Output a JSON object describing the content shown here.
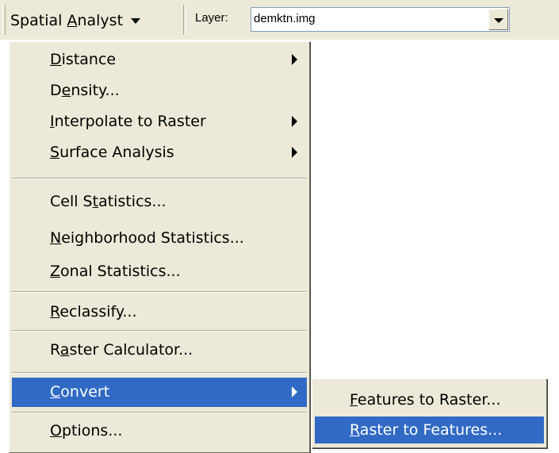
{
  "toolbar": {
    "spatial_analyst": {
      "pre": "Spatial ",
      "key": "A",
      "post": "nalyst"
    },
    "layer_label": "Layer:",
    "layer_value": "demktn.img"
  },
  "main_menu": {
    "distance": {
      "pre": "",
      "key": "D",
      "post": "istance"
    },
    "density": {
      "pre": "D",
      "key": "e",
      "post": "nsity..."
    },
    "interpolate": {
      "pre": "",
      "key": "I",
      "post": "nterpolate to Raster"
    },
    "surface": {
      "pre": "",
      "key": "S",
      "post": "urface Analysis"
    },
    "cell_stats": {
      "pre": "Cell S",
      "key": "t",
      "post": "atistics..."
    },
    "neighborhood": {
      "pre": "",
      "key": "N",
      "post": "eighborhood Statistics..."
    },
    "zonal": {
      "pre": "",
      "key": "Z",
      "post": "onal Statistics..."
    },
    "reclassify": {
      "pre": "",
      "key": "R",
      "post": "eclassify..."
    },
    "raster_calc": {
      "pre": "R",
      "key": "a",
      "post": "ster Calculator..."
    },
    "convert": {
      "pre": "",
      "key": "C",
      "post": "onvert"
    },
    "options": {
      "pre": "",
      "key": "O",
      "post": "ptions..."
    }
  },
  "sub_menu": {
    "features_to_raster": {
      "pre": "",
      "key": "F",
      "post": "eatures to Raster..."
    },
    "raster_to_features": {
      "pre": "",
      "key": "R",
      "post": "aster to Features..."
    }
  },
  "colors": {
    "menu_bg": "#ece9d8",
    "highlight": "#316ac5",
    "highlight_text": "#ffffff"
  }
}
